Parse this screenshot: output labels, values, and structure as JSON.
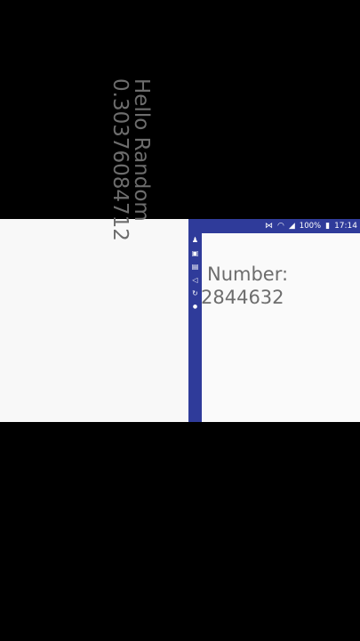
{
  "left": {
    "line1": "Hello Random",
    "line2": "0.30376084712"
  },
  "right": {
    "statusbar": {
      "signal_text": "100%",
      "clock": "17:14"
    },
    "line1": "Number:",
    "line2": "2844632"
  }
}
